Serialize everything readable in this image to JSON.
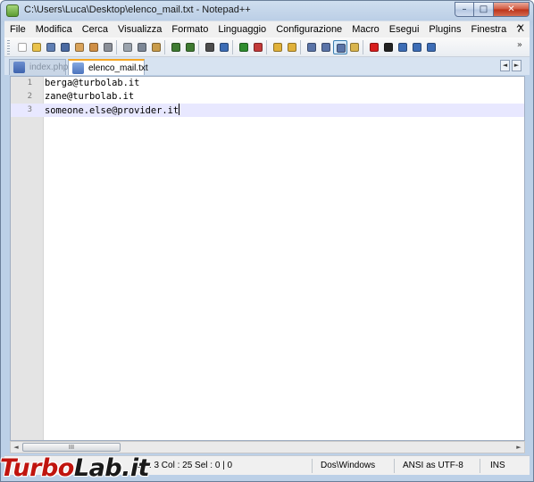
{
  "window": {
    "title": "C:\\Users\\Luca\\Desktop\\elenco_mail.txt - Notepad++",
    "app_icon": "notepad-plus-plus-icon"
  },
  "caption_buttons": {
    "minimize": "–",
    "maximize": "□",
    "close": "✕"
  },
  "menu": {
    "items": [
      "File",
      "Modifica",
      "Cerca",
      "Visualizza",
      "Formato",
      "Linguaggio",
      "Configurazione",
      "Macro",
      "Esegui",
      "Plugins",
      "Finestra",
      "?"
    ],
    "close_label": "X"
  },
  "toolbar": {
    "overflow_label": "»",
    "buttons": [
      {
        "name": "new-file-icon",
        "color": "#ffffff"
      },
      {
        "name": "open-file-icon",
        "color": "#e9c24a"
      },
      {
        "name": "save-icon",
        "color": "#5f7fb4"
      },
      {
        "name": "save-all-icon",
        "color": "#4a6aa2"
      },
      {
        "name": "close-icon",
        "color": "#d9a35a"
      },
      {
        "name": "close-all-icon",
        "color": "#cf8f46"
      },
      {
        "name": "print-icon",
        "color": "#8a8f98"
      },
      {
        "name": "cut-icon",
        "color": "#9aa3ad"
      },
      {
        "name": "copy-icon",
        "color": "#7c8796"
      },
      {
        "name": "paste-icon",
        "color": "#c89b4a"
      },
      {
        "name": "undo-icon",
        "color": "#3f7b32"
      },
      {
        "name": "redo-icon",
        "color": "#3f7b32"
      },
      {
        "name": "find-icon",
        "color": "#4d4d4d"
      },
      {
        "name": "replace-icon",
        "color": "#3d6db6"
      },
      {
        "name": "zoom-in-icon",
        "color": "#2f8d2f"
      },
      {
        "name": "zoom-out-icon",
        "color": "#c23a3a"
      },
      {
        "name": "sync-vertical-icon",
        "color": "#e0b13a"
      },
      {
        "name": "sync-horizontal-icon",
        "color": "#e0b13a"
      },
      {
        "name": "word-wrap-icon",
        "color": "#5a74a8"
      },
      {
        "name": "show-all-chars-icon",
        "color": "#5a74a8"
      },
      {
        "name": "indent-guide-icon",
        "color": "#5a74a8"
      },
      {
        "name": "user-language-icon",
        "color": "#d9b54e"
      },
      {
        "name": "record-macro-icon",
        "color": "#d81e1e"
      },
      {
        "name": "stop-macro-icon",
        "color": "#222222"
      },
      {
        "name": "play-macro-icon",
        "color": "#3d6db6"
      },
      {
        "name": "run-macro-multiple-icon",
        "color": "#3d6db6"
      },
      {
        "name": "save-macro-icon",
        "color": "#3d6db6"
      }
    ]
  },
  "tabs": [
    {
      "label": "index.php",
      "active": false
    },
    {
      "label": "elenco_mail.txt",
      "active": true
    }
  ],
  "tab_nav": {
    "prev": "◄",
    "next": "►"
  },
  "editor": {
    "current_line": 3,
    "lines": [
      {
        "number": "1",
        "text": "berga@turbolab.it"
      },
      {
        "number": "2",
        "text": "zane@turbolab.it"
      },
      {
        "number": "3",
        "text": "someone.else@provider.it"
      }
    ]
  },
  "hscroll": {
    "left": "◄",
    "right": "►",
    "thumb_grip": "III"
  },
  "status": {
    "position": "Ln : 3    Col : 25    Sel : 0 | 0",
    "eol": "Dos\\Windows",
    "encoding": "ANSI as UTF-8",
    "mode": "INS"
  },
  "watermark": {
    "part1": "Turbo",
    "part2": "Lab.it",
    "color": "#c0140e"
  }
}
